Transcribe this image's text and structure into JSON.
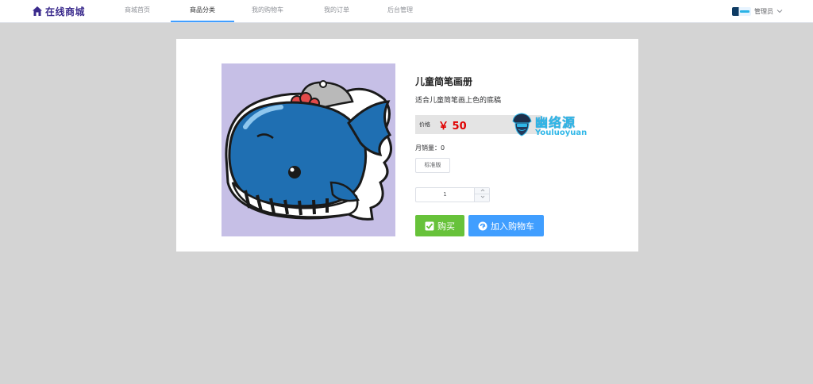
{
  "header": {
    "logo_text": "在线商城",
    "nav": [
      {
        "label": "商城首页",
        "active": false
      },
      {
        "label": "商品分类",
        "active": true
      },
      {
        "label": "我的购物车",
        "active": false
      },
      {
        "label": "我的订单",
        "active": false
      },
      {
        "label": "后台管理",
        "active": false
      }
    ],
    "user": {
      "name": "管理员",
      "dropdown_icon": "chevron-down-icon"
    }
  },
  "product": {
    "title": "儿童简笔画册",
    "description": "适合儿童简笔画上色的底稿",
    "price_label": "价格",
    "price": "￥ 50",
    "monthly_sales": "月销量：0",
    "variant": "标准版",
    "quantity": "1",
    "buy_label": "购买",
    "add_to_cart_label": "加入购物车",
    "image_icon": "cartoon-whale-image"
  },
  "watermark": {
    "cn": "幽络源",
    "en": "Youluoyuan"
  },
  "colors": {
    "accent": "#409eff",
    "success": "#67c23a",
    "price": "#e00000",
    "background": "#d4d4d4"
  }
}
